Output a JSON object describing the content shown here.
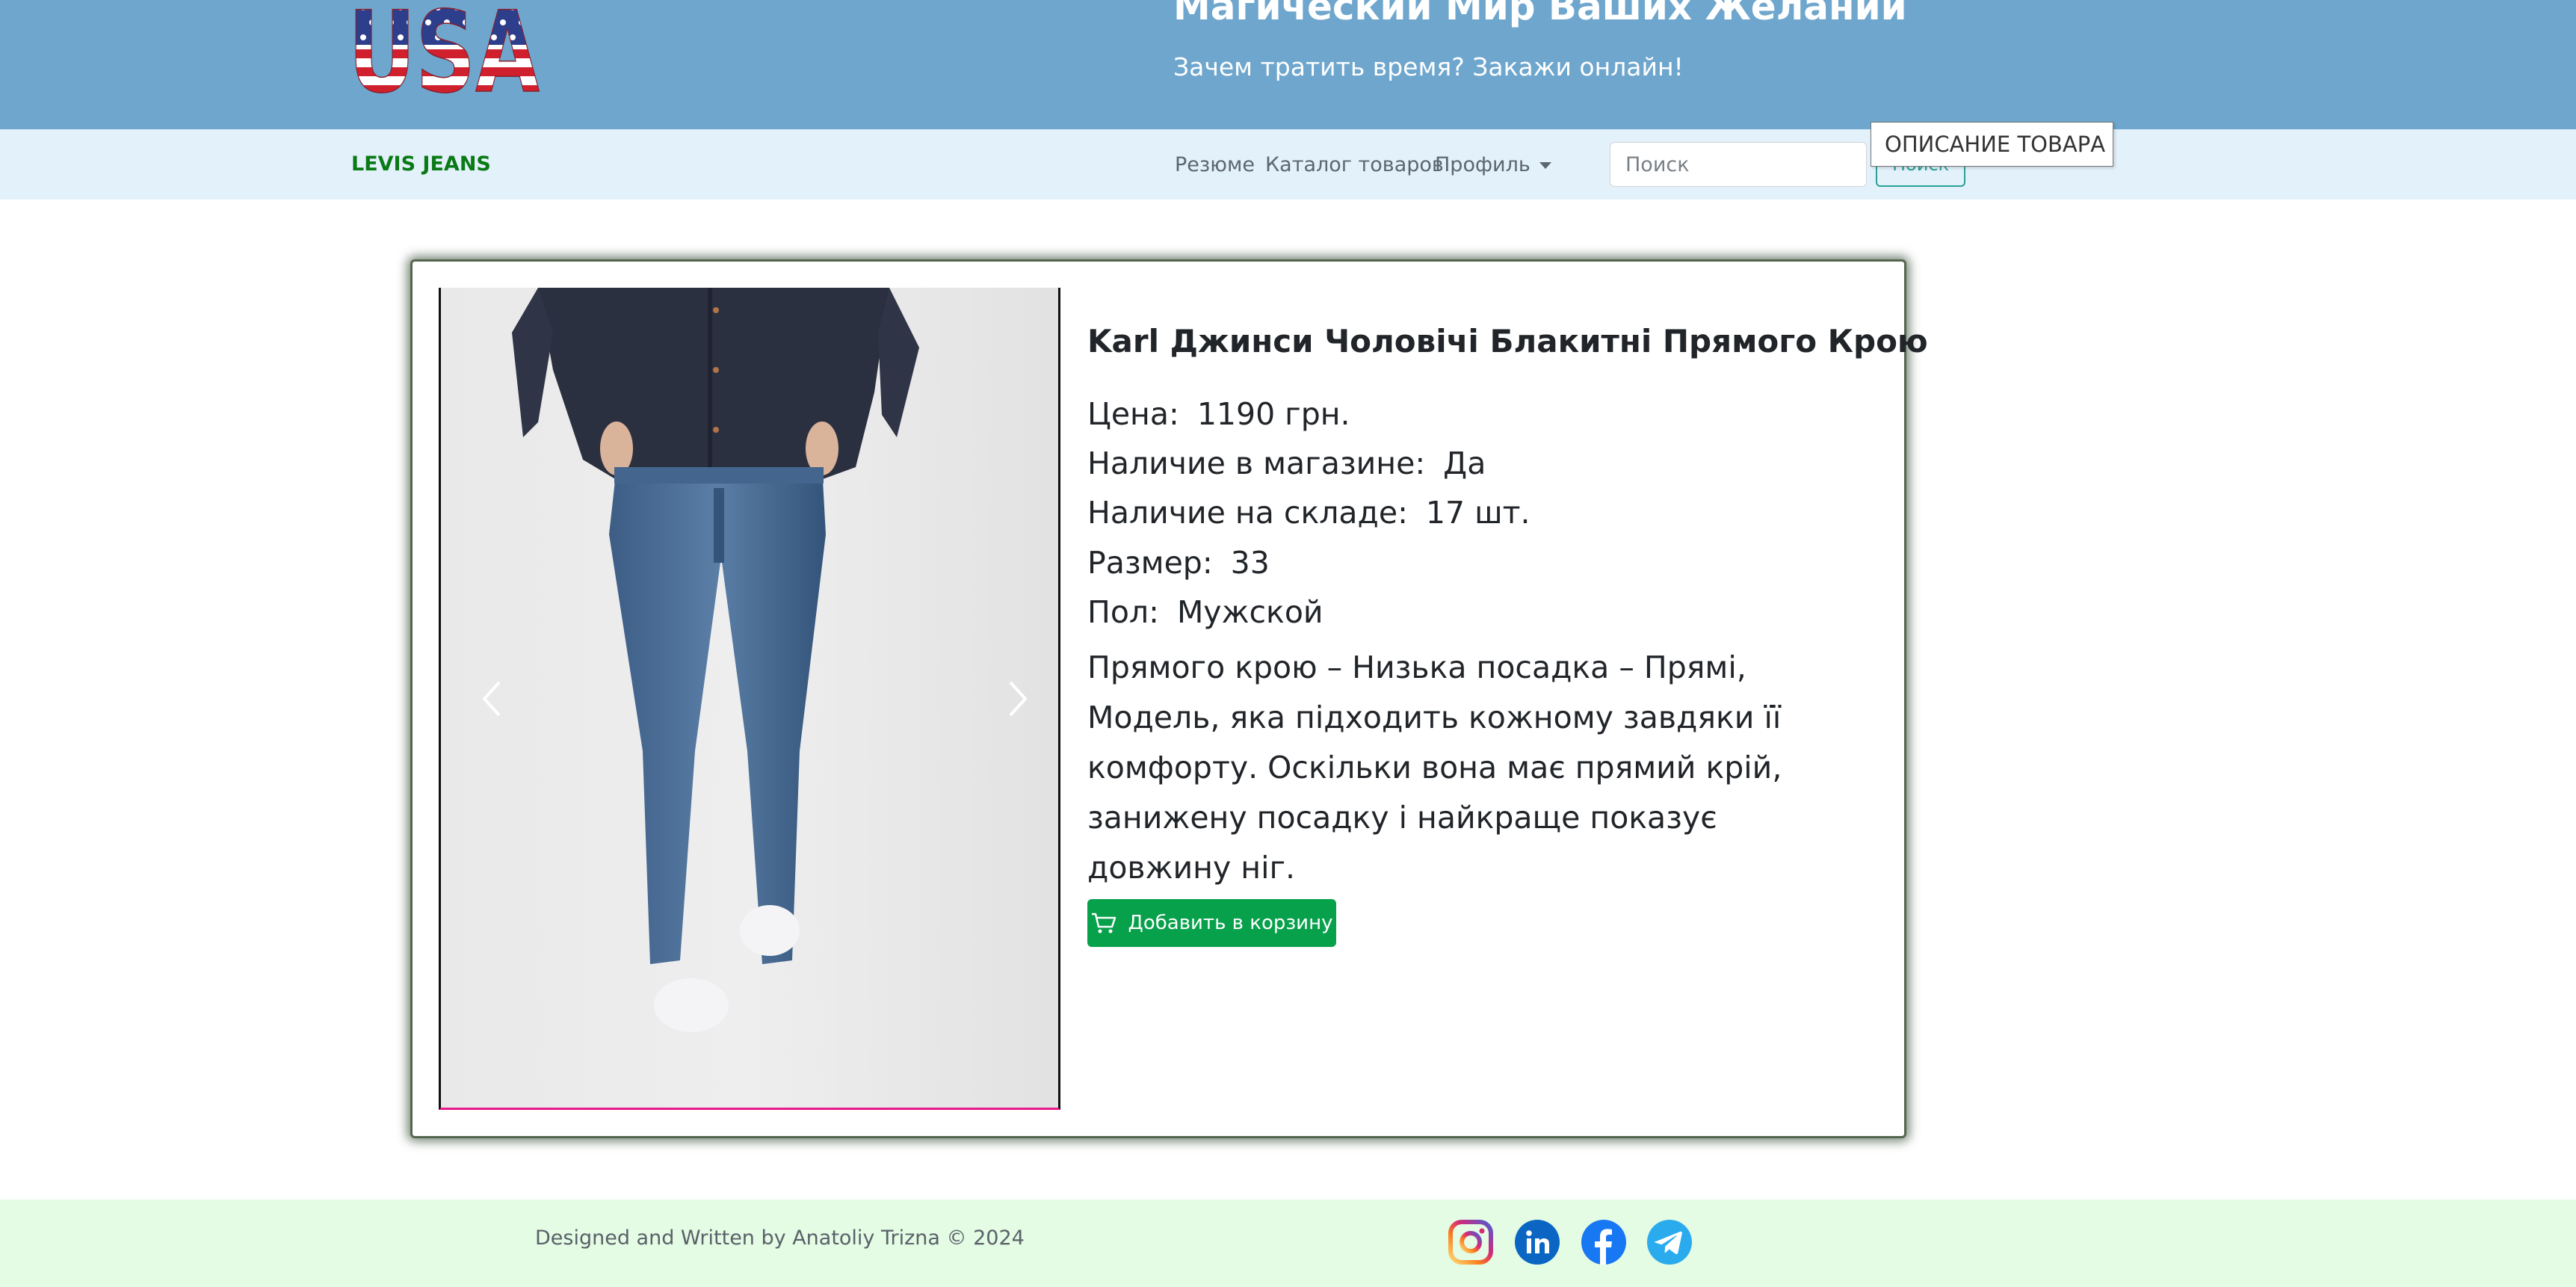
{
  "header": {
    "logo_text": "USA",
    "title": "Магический Мир Ваших Желаний",
    "subtitle": "Зачем тратить время? Закажи онлайн!"
  },
  "navbar": {
    "brand": "LEVIS JEANS",
    "links": [
      {
        "label": "Резюме"
      },
      {
        "label": "Каталог товаров"
      },
      {
        "label": "Профиль",
        "icon": "caret-down-icon"
      }
    ],
    "search": {
      "placeholder": "Поиск",
      "value": "",
      "button_label": "Поиск"
    },
    "tooltip": "ОПИСАНИЕ ТОВАРА"
  },
  "product": {
    "name": "Karl Джинси Чоловічі Блакитні Прямого Крою",
    "details": [
      {
        "label": "Цена:",
        "value": "1190 грн."
      },
      {
        "label": "Наличие в магазине:",
        "value": "Да"
      },
      {
        "label": "Наличие на складе:",
        "value": "17 шт."
      },
      {
        "label": "Размер:",
        "value": "33"
      },
      {
        "label": "Пол:",
        "value": "Мужской"
      }
    ],
    "description": " Прямого крою – Низька посадка – Прямі, Модель, яка підходить кожному завдяки її комфорту. Оскільки вона має прямий крій, занижену посадку і найкраще показує довжину ніг.",
    "add_to_cart_label": "Добавить в корзину",
    "carousel": {
      "prev_icon": "chevron-left-icon",
      "next_icon": "chevron-right-icon"
    }
  },
  "footer": {
    "copyright": "Designed and Written by Anatoliy Trizna © 2024",
    "social": [
      "instagram-icon",
      "linkedin-icon",
      "facebook-icon",
      "telegram-icon"
    ]
  },
  "colors": {
    "header_bg": "#6ea6cd",
    "navbar_bg": "#e3f1fb",
    "brand": "#0a7a16",
    "cart_button": "#07a04b",
    "footer_bg": "#e4fbe4"
  }
}
